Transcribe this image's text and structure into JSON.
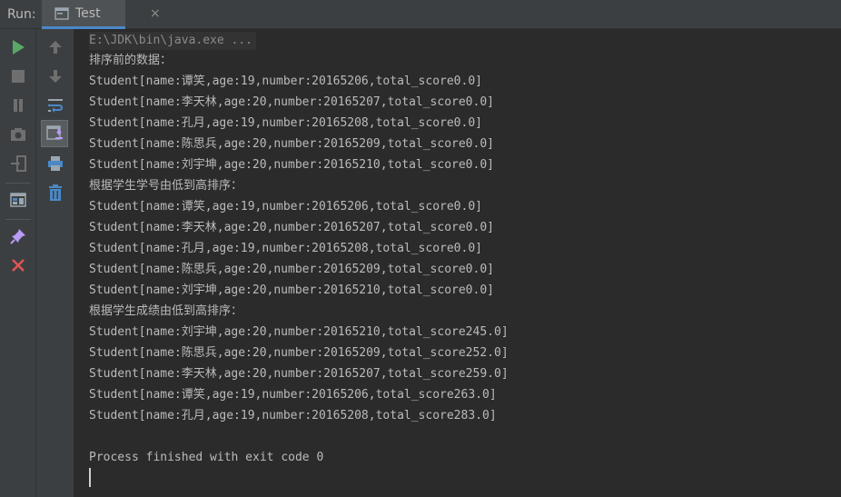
{
  "run_panel": {
    "run_label": "Run:",
    "tab_label": "Test",
    "tab_close": "×"
  },
  "toolbar_left": [
    {
      "name": "rerun-icon",
      "color": "#59a869"
    },
    {
      "name": "stop-icon",
      "color": "#6f6f6f"
    },
    {
      "name": "pause-icon",
      "color": "#6f6f6f"
    },
    {
      "name": "camera-dump-icon",
      "color": "#6f6f6f"
    },
    {
      "name": "exit-icon",
      "color": "#6f6f6f"
    },
    {
      "name": "layout-icon",
      "color": "#9aa7b0"
    },
    {
      "name": "pin-icon",
      "color": "#b99bf8"
    },
    {
      "name": "close-icon",
      "color": "#e05555"
    }
  ],
  "toolbar_right": [
    {
      "name": "up-arrow-icon"
    },
    {
      "name": "down-arrow-icon"
    },
    {
      "name": "soft-wrap-icon"
    },
    {
      "name": "scroll-to-end-icon"
    },
    {
      "name": "print-icon"
    },
    {
      "name": "trash-icon"
    }
  ],
  "console": {
    "command": "E:\\JDK\\bin\\java.exe ...",
    "lines": [
      "排序前的数据：",
      "Student[name:谭笑,age:19,number:20165206,total_score0.0]",
      "Student[name:李天林,age:20,number:20165207,total_score0.0]",
      "Student[name:孔月,age:19,number:20165208,total_score0.0]",
      "Student[name:陈思兵,age:20,number:20165209,total_score0.0]",
      "Student[name:刘宇坤,age:20,number:20165210,total_score0.0]",
      "根据学生学号由低到高排序：",
      "Student[name:谭笑,age:19,number:20165206,total_score0.0]",
      "Student[name:李天林,age:20,number:20165207,total_score0.0]",
      "Student[name:孔月,age:19,number:20165208,total_score0.0]",
      "Student[name:陈思兵,age:20,number:20165209,total_score0.0]",
      "Student[name:刘宇坤,age:20,number:20165210,total_score0.0]",
      "根据学生成绩由低到高排序：",
      "Student[name:刘宇坤,age:20,number:20165210,total_score245.0]",
      "Student[name:陈思兵,age:20,number:20165209,total_score252.0]",
      "Student[name:李天林,age:20,number:20165207,total_score259.0]",
      "Student[name:谭笑,age:19,number:20165206,total_score263.0]",
      "Student[name:孔月,age:19,number:20165208,total_score283.0]",
      "",
      "Process finished with exit code 0"
    ]
  }
}
